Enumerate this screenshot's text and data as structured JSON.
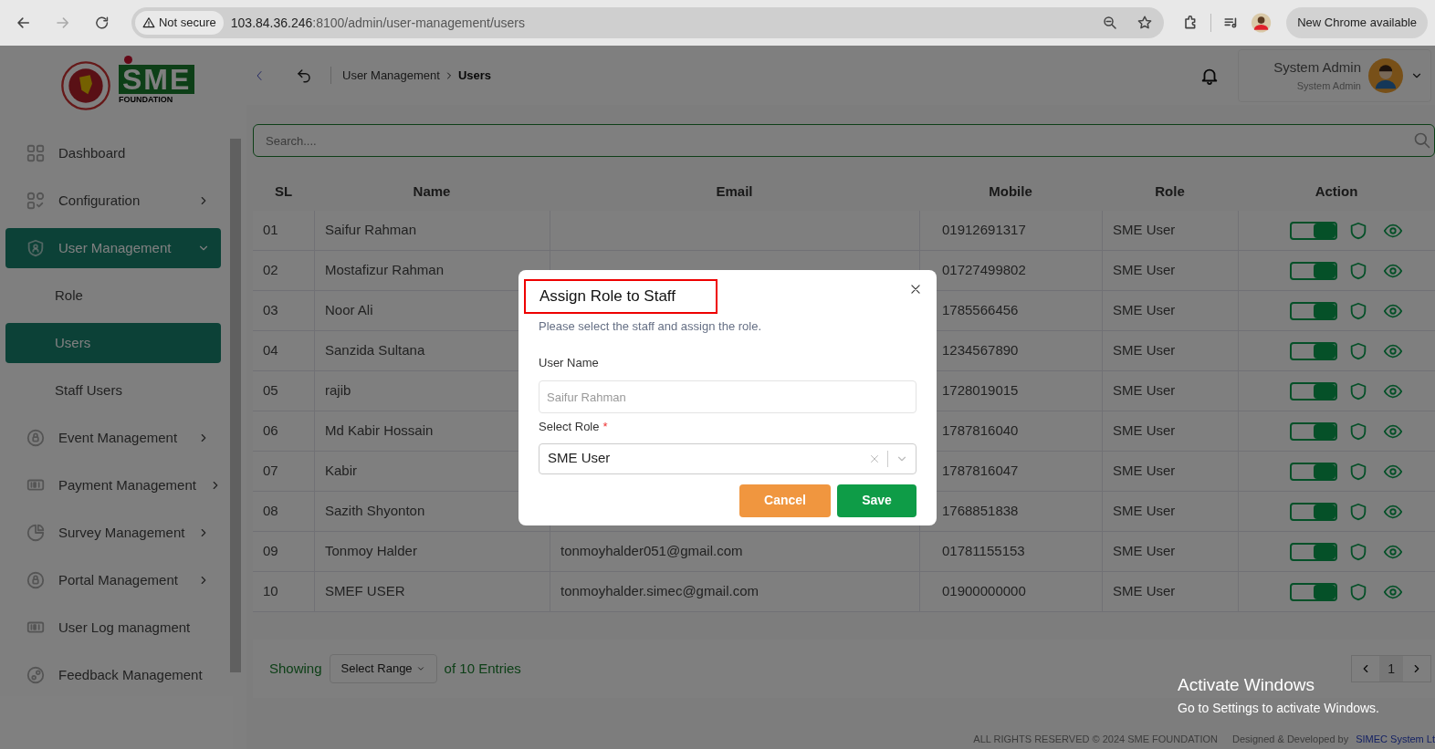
{
  "browser": {
    "security_label": "Not secure",
    "url_host": "103.84.36.246",
    "url_rest": ":8100/admin/user-management/users",
    "update_label": "New Chrome available"
  },
  "logo": {
    "letters": "SME",
    "subtitle": "FOUNDATION"
  },
  "sidebar": {
    "items": [
      {
        "label": "Dashboard",
        "selected": false
      },
      {
        "label": "Configuration",
        "selected": false,
        "expanded": false
      },
      {
        "label": "User Management",
        "selected": true,
        "expanded": true,
        "children": [
          {
            "label": "Role",
            "selected": false
          },
          {
            "label": "Users",
            "selected": true
          },
          {
            "label": "Staff Users",
            "selected": false
          }
        ]
      },
      {
        "label": "Event Management",
        "selected": false,
        "expanded": false
      },
      {
        "label": "Payment Management",
        "selected": false,
        "expanded": false
      },
      {
        "label": "Survey Management",
        "selected": false,
        "expanded": false
      },
      {
        "label": "Portal Management",
        "selected": false,
        "expanded": false
      },
      {
        "label": "User Log managment",
        "selected": false
      },
      {
        "label": "Feedback Management",
        "selected": false
      }
    ]
  },
  "header": {
    "breadcrumb": [
      "User Management",
      "Users"
    ],
    "user_name": "System Admin",
    "user_role": "System Admin"
  },
  "search": {
    "placeholder": "Search...."
  },
  "table": {
    "columns": [
      "SL",
      "Name",
      "Email",
      "Mobile",
      "Role",
      "Action"
    ],
    "rows": [
      {
        "sl": "01",
        "name": "Saifur Rahman",
        "mobile": "01912691317",
        "role": "SME User",
        "on": true
      },
      {
        "sl": "02",
        "name": "Mostafizur Rahman",
        "mobile": "01727499802",
        "role": "SME User",
        "on": true
      },
      {
        "sl": "03",
        "name": "Noor Ali",
        "mobile": "1785566456",
        "role": "SME User",
        "on": true
      },
      {
        "sl": "04",
        "name": "Sanzida Sultana",
        "mobile": "1234567890",
        "role": "SME User",
        "on": true
      },
      {
        "sl": "05",
        "name": "rajib",
        "mobile": "1728019015",
        "role": "SME User",
        "on": true
      },
      {
        "sl": "06",
        "name": "Md Kabir Hossain",
        "mobile": "1787816040",
        "role": "SME User",
        "on": true
      },
      {
        "sl": "07",
        "name": "Kabir",
        "mobile": "1787816047",
        "role": "SME User",
        "on": true
      },
      {
        "sl": "08",
        "name": "Sazith Shyonton",
        "mobile": "1768851838",
        "role": "SME User",
        "on": true
      },
      {
        "sl": "09",
        "name": "Tonmoy Halder",
        "email": "tonmoyhalder051@gmail.com",
        "mobile": "01781155153",
        "role": "SME User",
        "on": true
      },
      {
        "sl": "10",
        "name": "SMEF USER",
        "email": "tonmoyhalder.simec@gmail.com",
        "mobile": "01900000000",
        "role": "SME User",
        "on": true
      }
    ]
  },
  "pagination": {
    "showing": "Showing",
    "range_placeholder": "Select Range",
    "entries": "of 10 Entries",
    "pages": [
      {
        "label": "1",
        "selected": true
      }
    ]
  },
  "footer": {
    "copyright": "ALL RIGHTS RESERVED © 2024 SME FOUNDATION",
    "credit": "Designed & Developed by",
    "link": "SIMEC System Lt"
  },
  "modal": {
    "title": "Assign Role to Staff",
    "title_highlighted": true,
    "subtitle": "Please select the staff and assign the role.",
    "user_name": {
      "label": "User Name",
      "placeholder": "Saifur Rahman"
    },
    "role": {
      "label": "Select Role",
      "required_mark": "*",
      "value": "SME User"
    },
    "buttons": [
      {
        "label": "Cancel",
        "kind": "secondary"
      },
      {
        "label": "Save",
        "kind": "primary"
      }
    ]
  },
  "os_notice": {
    "title": "Activate Windows",
    "text": "Go to Settings to activate Windows."
  }
}
